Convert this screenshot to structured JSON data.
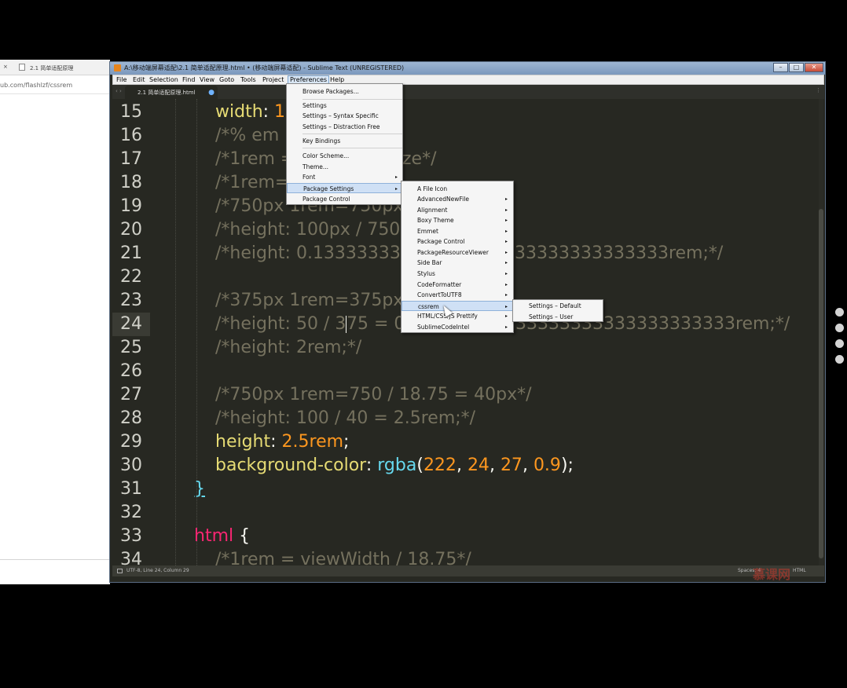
{
  "browser": {
    "close_glyph": "×",
    "tab_label": "2.1 简单适配原理",
    "url": "ub.com/flashlzf/cssrem"
  },
  "window": {
    "title": "A:\\移动端屏幕适配\\2.1 简单适配原理.html • (移动端屏幕适配) - Sublime Text (UNREGISTERED)",
    "min": "–",
    "max": "□",
    "close": "✕"
  },
  "menubar": [
    "File",
    "Edit",
    "Selection",
    "Find",
    "View",
    "Goto",
    "Tools",
    "Project",
    "Preferences",
    "Help"
  ],
  "tab": {
    "nav": "‹ ›",
    "label": "2.1 简单适配原理.html",
    "dirty": "●",
    "more": "⋮"
  },
  "code_lines": [
    {
      "num": "15"
    },
    {
      "num": "16"
    },
    {
      "num": "17"
    },
    {
      "num": "18"
    },
    {
      "num": "19"
    },
    {
      "num": "20"
    },
    {
      "num": "21"
    },
    {
      "num": "22"
    },
    {
      "num": "23"
    },
    {
      "num": "24"
    },
    {
      "num": "25"
    },
    {
      "num": "26"
    },
    {
      "num": "27"
    },
    {
      "num": "28"
    },
    {
      "num": "29"
    },
    {
      "num": "30"
    },
    {
      "num": "31"
    },
    {
      "num": "32"
    },
    {
      "num": "33"
    },
    {
      "num": "34"
    }
  ],
  "code": {
    "l15_prop": "width",
    "l15_colon": ": ",
    "l15_val": "10",
    "l16": "/*% em",
    "l17a": "/*1rem =",
    "l17b": "ze*/",
    "l18": "/*1rem=",
    "l19": "/*750px 1rem=750px",
    "l20": "/*height: 100px / 750p",
    "l21a": "/*height: 0.1333333333",
    "l21b": "33333333333333rem;*/",
    "l23": "/*375px 1rem=375px",
    "l24a": "/*height: 50 / 3",
    "l24b": "75 = 0",
    "l24c": "33333333333333333333rem;*/",
    "l25": "/*height: 2rem;*/",
    "l27": "/*750px 1rem=750 / 18.75 = 40px*/",
    "l28": "/*height: 100 / 40 = 2.5rem;*/",
    "l29_prop": "height",
    "l29_colon": ": ",
    "l29_val": "2.5rem",
    "l29_semi": ";",
    "l30_prop": "background-color",
    "l30_colon": ": ",
    "l30_fn": "rgba",
    "l30_p1": "(",
    "l30_a": "222",
    "l30_c1": ", ",
    "l30_b": "24",
    "l30_c2": ", ",
    "l30_c": "27",
    "l30_c3": ", ",
    "l30_d": "0.9",
    "l30_end": ");",
    "l31": "}",
    "l33_sel": "html",
    "l33_brace": " {",
    "l34": "/*1rem = viewWidth / 18.75*/"
  },
  "preferences_menu": {
    "items": [
      "Browse Packages...",
      "Settings",
      "Settings – Syntax Specific",
      "Settings – Distraction Free",
      "Key Bindings",
      "Color Scheme...",
      "Theme...",
      "Font",
      "Package Settings",
      "Package Control"
    ],
    "arrow": "▸"
  },
  "package_settings_menu": {
    "items": [
      "A File Icon",
      "AdvancedNewFile",
      "Alignment",
      "Boxy Theme",
      "Emmet",
      "Package Control",
      "PackageResourceViewer",
      "Side Bar",
      "Stylus",
      "CodeFormatter",
      "ConvertToUTF8",
      "cssrem",
      "HTML/CSS/JS Prettify",
      "SublimeCodeIntel"
    ],
    "arrow": "▸"
  },
  "cssrem_menu": {
    "items": [
      "Settings – Default",
      "Settings – User"
    ]
  },
  "statusbar": {
    "position": "UTF-8, Line 24, Column 29",
    "spaces": "Spaces: 4",
    "syntax": "HTML"
  },
  "watermark": "慕课网",
  "colors": {
    "editor_bg": "#272822",
    "comment": "#75715e",
    "property": "#e6db74",
    "number": "#fd971f",
    "function": "#66d9ef",
    "selector": "#f92672"
  }
}
